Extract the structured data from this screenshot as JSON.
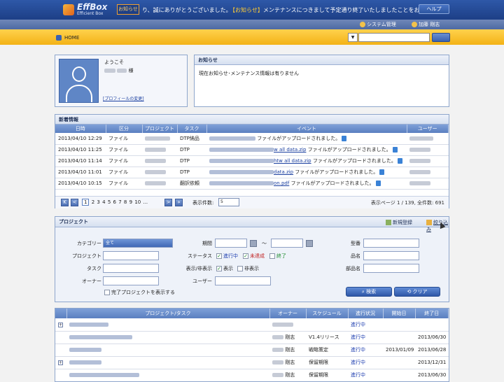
{
  "header": {
    "logo_main": "EffBox",
    "logo_sub": "Efficient Box",
    "oshirase_btn": "お知らせ",
    "marquee_left": "り、誠にありがとうございました。",
    "marquee_tag": "【お知らせ】",
    "marquee_text": "メンテナンスにつきまして予定通り終了いたしましたことをお知らせしま",
    "help": "ヘルプ",
    "system_menu": "システム管理",
    "user_name": "加藤 剛志"
  },
  "nav": {
    "home": "HOME",
    "search_select": "▼"
  },
  "welcome": {
    "label": "ようこそ",
    "suffix": "様",
    "profile_link": "[プロフィールの変更]"
  },
  "notice": {
    "title": "お知らせ",
    "text": "現在お知らせ･メンテナンス情報は有りません"
  },
  "news": {
    "title": "新着情報",
    "columns": [
      "日時",
      "区分",
      "プロジェクト",
      "タスク",
      "イベント",
      "ユーザー"
    ],
    "rows": [
      {
        "date": "2013/04/10 12:29",
        "kind": "ファイル",
        "task": "DTP納品",
        "file": "",
        "event": "ファイルがアップロードされました。"
      },
      {
        "date": "2013/04/10 11:25",
        "kind": "ファイル",
        "task": "DTP",
        "file": "w all data.zip",
        "event": "ファイルがアップロードされました。"
      },
      {
        "date": "2013/04/10 11:14",
        "kind": "ファイル",
        "task": "DTP",
        "file": "htw all data.zip",
        "event": "ファイルがアップロードされました。"
      },
      {
        "date": "2013/04/10 11:01",
        "kind": "ファイル",
        "task": "DTP",
        "file": "data.zip",
        "event": "ファイルがアップロードされました。"
      },
      {
        "date": "2013/04/10 10:15",
        "kind": "ファイル",
        "task": "翻訳依頼",
        "file": "on.pdf",
        "event": "ファイルがアップロードされました。"
      }
    ],
    "pager": {
      "first": "K",
      "prev": "<",
      "pages": [
        "1",
        "2",
        "3",
        "4",
        "5",
        "6",
        "7",
        "8",
        "9",
        "10",
        "..."
      ],
      "next": ">",
      "last": "»",
      "count_label": "表示件数:",
      "count_value": "5",
      "page_info": "表示ページ 1 / 139, 全件数: 691"
    }
  },
  "project_search": {
    "title": "プロジェクト",
    "new_reg": "新規登録",
    "narrow": "絞り込み",
    "category_label": "カテゴリー",
    "category_value": "全て",
    "project_label": "プロジェクト",
    "task_label": "タスク",
    "owner_label": "オーナー",
    "show_done": "完了プロジェクトを表示する",
    "period_label": "期間",
    "period_sep": "～",
    "status_label": "ステータス",
    "status_opts": [
      "進行中",
      "未達成",
      "終了"
    ],
    "display_label": "表示/非表示",
    "display_opts": [
      "表示",
      "非表示"
    ],
    "user_label": "ユーザー",
    "model_label": "型番",
    "product_label": "品名",
    "dept_label": "部品名",
    "search_btn": "検索",
    "clear_btn": "クリア"
  },
  "project_table": {
    "columns": [
      "",
      "プロジェクト/タスク",
      "オーナー",
      "スケジュール",
      "進行状況",
      "開始日",
      "終了日"
    ],
    "rows": [
      {
        "plus": "+",
        "owner_suffix": "",
        "schedule": "",
        "status": "進行中",
        "start": "",
        "end": ""
      },
      {
        "plus": "",
        "owner_suffix": "剛志",
        "schedule": "V1.4リリース",
        "status": "進行中",
        "start": "",
        "end": "2013/06/30"
      },
      {
        "plus": "",
        "owner_suffix": "剛志",
        "schedule": "戦略策定",
        "status": "進行中",
        "start": "2013/01/09",
        "end": "2013/06/28"
      },
      {
        "plus": "+",
        "owner_suffix": "剛志",
        "schedule": "保留期限",
        "status": "進行中",
        "start": "",
        "end": "2013/12/31"
      },
      {
        "plus": "",
        "owner_suffix": "剛志",
        "schedule": "保留期限",
        "status": "進行中",
        "start": "",
        "end": "2013/06/30"
      }
    ]
  }
}
